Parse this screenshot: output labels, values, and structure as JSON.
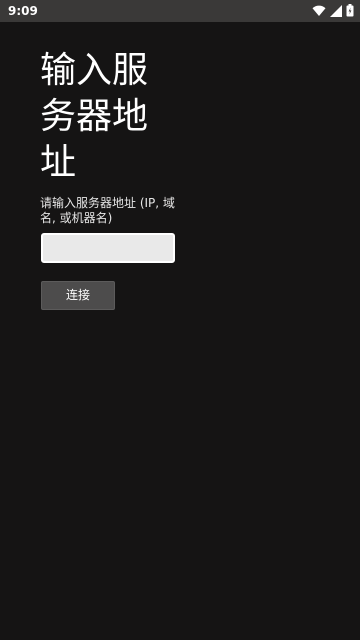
{
  "status_bar": {
    "time": "9:09",
    "icons": [
      "wifi-icon",
      "cell-signal-icon",
      "battery-icon"
    ]
  },
  "form": {
    "title": "输入服务器地址",
    "label": "请输入服务器地址 (IP, 域名, 或机器名)",
    "input_value": "",
    "input_placeholder": "",
    "connect_button": "连接"
  },
  "colors": {
    "background": "#151414",
    "status_bar": "#3a3938",
    "input_background": "#e9e9e9",
    "button_background": "#4d4c4c"
  }
}
